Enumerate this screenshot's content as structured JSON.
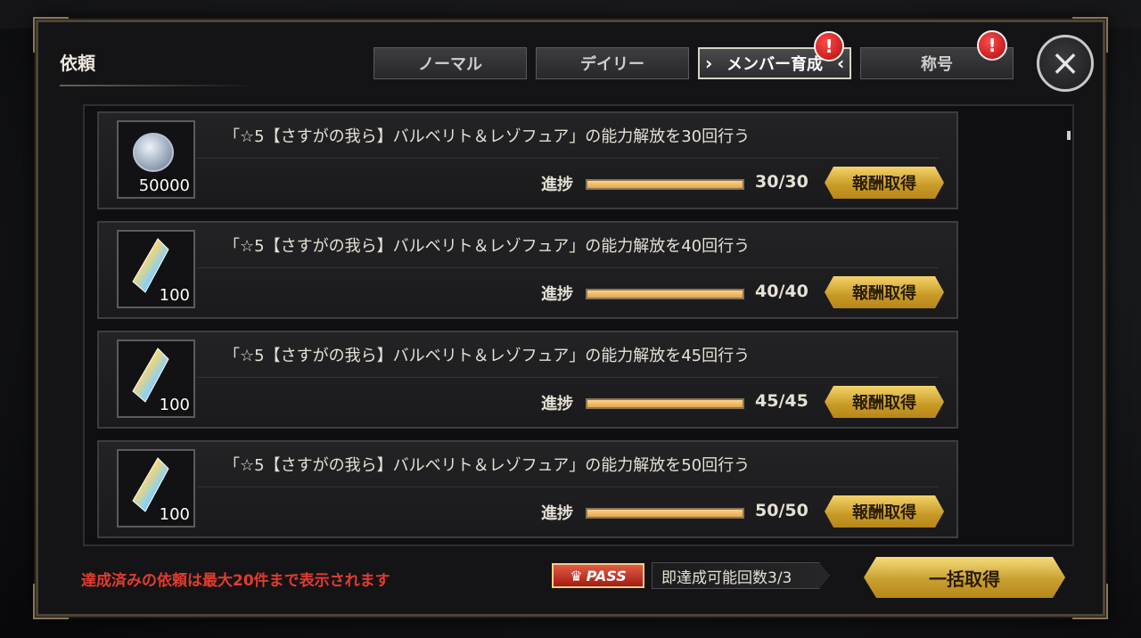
{
  "dialog": {
    "title": "依頼",
    "tabs": [
      {
        "label": "ノーマル",
        "active": false,
        "alert": false
      },
      {
        "label": "デイリー",
        "active": false,
        "alert": false
      },
      {
        "label": "メンバー育成",
        "active": true,
        "alert": true
      },
      {
        "label": "称号",
        "active": false,
        "alert": true
      }
    ],
    "alert_symbol": "!",
    "close_symbol": "×"
  },
  "quests": [
    {
      "description": "「☆5【さすがの我ら】バルベリト＆レゾフュア」の能力解放を30回行う",
      "reward_icon": "silver-coin-icon",
      "reward_amount": "50000",
      "progress_label": "進捗",
      "progress_text": "30/30",
      "progress_fraction": 1.0,
      "claim_label": "報酬取得"
    },
    {
      "description": "「☆5【さすがの我ら】バルベリト＆レゾフュア」の能力解放を40回行う",
      "reward_icon": "crystal-icon",
      "reward_amount": "100",
      "progress_label": "進捗",
      "progress_text": "40/40",
      "progress_fraction": 1.0,
      "claim_label": "報酬取得"
    },
    {
      "description": "「☆5【さすがの我ら】バルベリト＆レゾフュア」の能力解放を45回行う",
      "reward_icon": "crystal-icon",
      "reward_amount": "100",
      "progress_label": "進捗",
      "progress_text": "45/45",
      "progress_fraction": 1.0,
      "claim_label": "報酬取得"
    },
    {
      "description": "「☆5【さすがの我ら】バルベリト＆レゾフュア」の能力解放を50回行う",
      "reward_icon": "crystal-icon",
      "reward_amount": "100",
      "progress_label": "進捗",
      "progress_text": "50/50",
      "progress_fraction": 1.0,
      "claim_label": "報酬取得"
    }
  ],
  "footer": {
    "note": "達成済みの依頼は最大20件まで表示されます",
    "pass_label": "PASS",
    "pass_info": "即達成可能回数3/3",
    "bulk_claim_label": "一括取得"
  },
  "colors": {
    "accent_gold": "#d4a93a",
    "alert_red": "#c41414",
    "note_red": "#e23b2f"
  }
}
